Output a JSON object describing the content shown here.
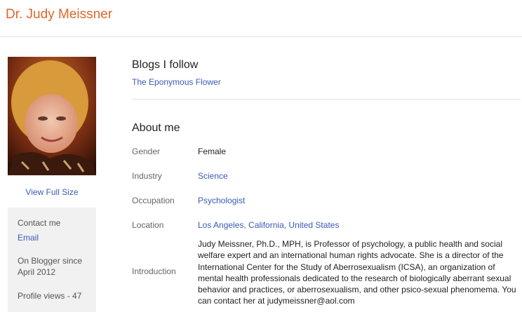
{
  "header": {
    "title": "Dr. Judy Meissner"
  },
  "sidebar": {
    "view_full_size": "View Full Size",
    "contact_label": "Contact me",
    "email_link": "Email",
    "blogger_since_line1": "On Blogger since",
    "blogger_since_line2": "April 2012",
    "profile_views": "Profile views - 47"
  },
  "blogs": {
    "title": "Blogs I follow",
    "items": [
      "The Eponymous Flower"
    ]
  },
  "about": {
    "title": "About me",
    "rows": [
      {
        "label": "Gender",
        "value": "Female"
      },
      {
        "label": "Industry",
        "value": "Science"
      },
      {
        "label": "Occupation",
        "value": "Psychologist"
      },
      {
        "label": "Location",
        "value": "Los Angeles, California, United States"
      }
    ],
    "introduction_label": "Introduction",
    "introduction_text": "Judy Meissner, Ph.D., MPH, is Professor of psychology, a public health and social welfare expert and an international human rights advocate. She is a director of the International Center for the Study of Aberrosexualism (ICSA), an organization of mental health professionals dedicated to the research of biologically aberrant sexual behavior and practices, or aberrosexualism, and other psico-sexual phenomema. You can contact her at judymeissner@aol.com"
  },
  "colors": {
    "title": "#e0662a",
    "link": "#3b5bb5"
  }
}
